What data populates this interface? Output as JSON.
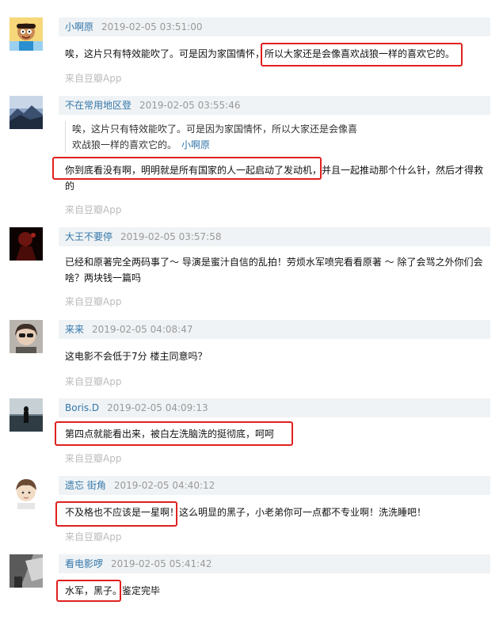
{
  "comments": [
    {
      "username": "小啊原",
      "time": "2019-02-05 03:51:00",
      "text": "唉，这片只有特效能吹了。可是因为家国情怀，所以大家还是会像喜欢战狼一样的喜欢它的。",
      "source": "来自豆瓣App"
    },
    {
      "username": "不在常用地区登",
      "time": "2019-02-05 03:55:46",
      "quote_line1": "唉，这片只有特效能吹了。可是因为家国情怀，所以大家还是会像喜",
      "quote_line2": "欢战狼一样的喜欢它的。",
      "quote_author": "小啊原",
      "text_line1": "你到底看没有啊，明明就是所有国家的人一起启动了发动机，并且一起推动那个什么针，然后才得救",
      "text_line2": "的",
      "source": "来自豆瓣App"
    },
    {
      "username": "大王不要停",
      "time": "2019-02-05 03:57:58",
      "text_line1": "已经和原著完全两码事了～ 导演是蜜汁自信的乱拍！劳烦水军喷完看看原著 ～ 除了会骂之外你们会",
      "text_line2": "啥？两块钱一篇吗",
      "source": "来自豆瓣App"
    },
    {
      "username": "来来",
      "time": "2019-02-05 04:08:47",
      "text": "这电影不会低于7分 楼主同意吗？",
      "source": "来自豆瓣App"
    },
    {
      "username": "Boris.D",
      "time": "2019-02-05 04:09:13",
      "text": "第四点就能看出来，被白左洗脑洗的挺彻底，呵呵",
      "source": "来自豆瓣App"
    },
    {
      "username": "遗忘 街角",
      "time": "2019-02-05 04:40:12",
      "text": "不及格也不应该是一星啊！这么明显的黑子，小老弟你可一点都不专业啊！洗洗睡吧！",
      "source": "来自豆瓣App"
    },
    {
      "username": "看电影啰",
      "time": "2019-02-05 05:41:42",
      "text": "水军，黑子。鉴定完毕",
      "source": ""
    }
  ],
  "colors": {
    "username": "#3377aa",
    "header_bg": "#f0f3f5",
    "timestamp": "#999999",
    "source": "#bbbbbb",
    "highlight_box": "#e02020"
  }
}
